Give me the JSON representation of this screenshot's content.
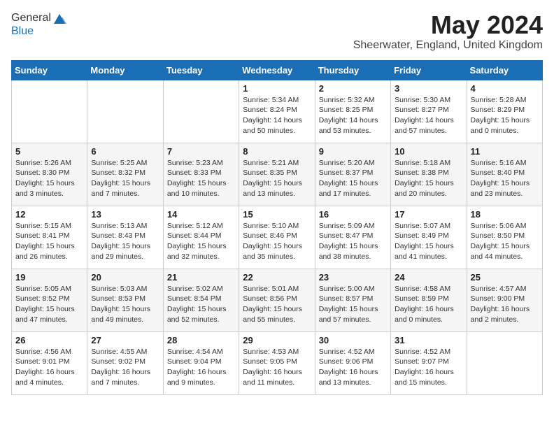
{
  "header": {
    "logo_general": "General",
    "logo_blue": "Blue",
    "month_title": "May 2024",
    "location": "Sheerwater, England, United Kingdom"
  },
  "days_of_week": [
    "Sunday",
    "Monday",
    "Tuesday",
    "Wednesday",
    "Thursday",
    "Friday",
    "Saturday"
  ],
  "weeks": [
    [
      {
        "day": "",
        "sunrise": "",
        "sunset": "",
        "daylight": ""
      },
      {
        "day": "",
        "sunrise": "",
        "sunset": "",
        "daylight": ""
      },
      {
        "day": "",
        "sunrise": "",
        "sunset": "",
        "daylight": ""
      },
      {
        "day": "1",
        "sunrise": "Sunrise: 5:34 AM",
        "sunset": "Sunset: 8:24 PM",
        "daylight": "Daylight: 14 hours and 50 minutes."
      },
      {
        "day": "2",
        "sunrise": "Sunrise: 5:32 AM",
        "sunset": "Sunset: 8:25 PM",
        "daylight": "Daylight: 14 hours and 53 minutes."
      },
      {
        "day": "3",
        "sunrise": "Sunrise: 5:30 AM",
        "sunset": "Sunset: 8:27 PM",
        "daylight": "Daylight: 14 hours and 57 minutes."
      },
      {
        "day": "4",
        "sunrise": "Sunrise: 5:28 AM",
        "sunset": "Sunset: 8:29 PM",
        "daylight": "Daylight: 15 hours and 0 minutes."
      }
    ],
    [
      {
        "day": "5",
        "sunrise": "Sunrise: 5:26 AM",
        "sunset": "Sunset: 8:30 PM",
        "daylight": "Daylight: 15 hours and 3 minutes."
      },
      {
        "day": "6",
        "sunrise": "Sunrise: 5:25 AM",
        "sunset": "Sunset: 8:32 PM",
        "daylight": "Daylight: 15 hours and 7 minutes."
      },
      {
        "day": "7",
        "sunrise": "Sunrise: 5:23 AM",
        "sunset": "Sunset: 8:33 PM",
        "daylight": "Daylight: 15 hours and 10 minutes."
      },
      {
        "day": "8",
        "sunrise": "Sunrise: 5:21 AM",
        "sunset": "Sunset: 8:35 PM",
        "daylight": "Daylight: 15 hours and 13 minutes."
      },
      {
        "day": "9",
        "sunrise": "Sunrise: 5:20 AM",
        "sunset": "Sunset: 8:37 PM",
        "daylight": "Daylight: 15 hours and 17 minutes."
      },
      {
        "day": "10",
        "sunrise": "Sunrise: 5:18 AM",
        "sunset": "Sunset: 8:38 PM",
        "daylight": "Daylight: 15 hours and 20 minutes."
      },
      {
        "day": "11",
        "sunrise": "Sunrise: 5:16 AM",
        "sunset": "Sunset: 8:40 PM",
        "daylight": "Daylight: 15 hours and 23 minutes."
      }
    ],
    [
      {
        "day": "12",
        "sunrise": "Sunrise: 5:15 AM",
        "sunset": "Sunset: 8:41 PM",
        "daylight": "Daylight: 15 hours and 26 minutes."
      },
      {
        "day": "13",
        "sunrise": "Sunrise: 5:13 AM",
        "sunset": "Sunset: 8:43 PM",
        "daylight": "Daylight: 15 hours and 29 minutes."
      },
      {
        "day": "14",
        "sunrise": "Sunrise: 5:12 AM",
        "sunset": "Sunset: 8:44 PM",
        "daylight": "Daylight: 15 hours and 32 minutes."
      },
      {
        "day": "15",
        "sunrise": "Sunrise: 5:10 AM",
        "sunset": "Sunset: 8:46 PM",
        "daylight": "Daylight: 15 hours and 35 minutes."
      },
      {
        "day": "16",
        "sunrise": "Sunrise: 5:09 AM",
        "sunset": "Sunset: 8:47 PM",
        "daylight": "Daylight: 15 hours and 38 minutes."
      },
      {
        "day": "17",
        "sunrise": "Sunrise: 5:07 AM",
        "sunset": "Sunset: 8:49 PM",
        "daylight": "Daylight: 15 hours and 41 minutes."
      },
      {
        "day": "18",
        "sunrise": "Sunrise: 5:06 AM",
        "sunset": "Sunset: 8:50 PM",
        "daylight": "Daylight: 15 hours and 44 minutes."
      }
    ],
    [
      {
        "day": "19",
        "sunrise": "Sunrise: 5:05 AM",
        "sunset": "Sunset: 8:52 PM",
        "daylight": "Daylight: 15 hours and 47 minutes."
      },
      {
        "day": "20",
        "sunrise": "Sunrise: 5:03 AM",
        "sunset": "Sunset: 8:53 PM",
        "daylight": "Daylight: 15 hours and 49 minutes."
      },
      {
        "day": "21",
        "sunrise": "Sunrise: 5:02 AM",
        "sunset": "Sunset: 8:54 PM",
        "daylight": "Daylight: 15 hours and 52 minutes."
      },
      {
        "day": "22",
        "sunrise": "Sunrise: 5:01 AM",
        "sunset": "Sunset: 8:56 PM",
        "daylight": "Daylight: 15 hours and 55 minutes."
      },
      {
        "day": "23",
        "sunrise": "Sunrise: 5:00 AM",
        "sunset": "Sunset: 8:57 PM",
        "daylight": "Daylight: 15 hours and 57 minutes."
      },
      {
        "day": "24",
        "sunrise": "Sunrise: 4:58 AM",
        "sunset": "Sunset: 8:59 PM",
        "daylight": "Daylight: 16 hours and 0 minutes."
      },
      {
        "day": "25",
        "sunrise": "Sunrise: 4:57 AM",
        "sunset": "Sunset: 9:00 PM",
        "daylight": "Daylight: 16 hours and 2 minutes."
      }
    ],
    [
      {
        "day": "26",
        "sunrise": "Sunrise: 4:56 AM",
        "sunset": "Sunset: 9:01 PM",
        "daylight": "Daylight: 16 hours and 4 minutes."
      },
      {
        "day": "27",
        "sunrise": "Sunrise: 4:55 AM",
        "sunset": "Sunset: 9:02 PM",
        "daylight": "Daylight: 16 hours and 7 minutes."
      },
      {
        "day": "28",
        "sunrise": "Sunrise: 4:54 AM",
        "sunset": "Sunset: 9:04 PM",
        "daylight": "Daylight: 16 hours and 9 minutes."
      },
      {
        "day": "29",
        "sunrise": "Sunrise: 4:53 AM",
        "sunset": "Sunset: 9:05 PM",
        "daylight": "Daylight: 16 hours and 11 minutes."
      },
      {
        "day": "30",
        "sunrise": "Sunrise: 4:52 AM",
        "sunset": "Sunset: 9:06 PM",
        "daylight": "Daylight: 16 hours and 13 minutes."
      },
      {
        "day": "31",
        "sunrise": "Sunrise: 4:52 AM",
        "sunset": "Sunset: 9:07 PM",
        "daylight": "Daylight: 16 hours and 15 minutes."
      },
      {
        "day": "",
        "sunrise": "",
        "sunset": "",
        "daylight": ""
      }
    ]
  ]
}
